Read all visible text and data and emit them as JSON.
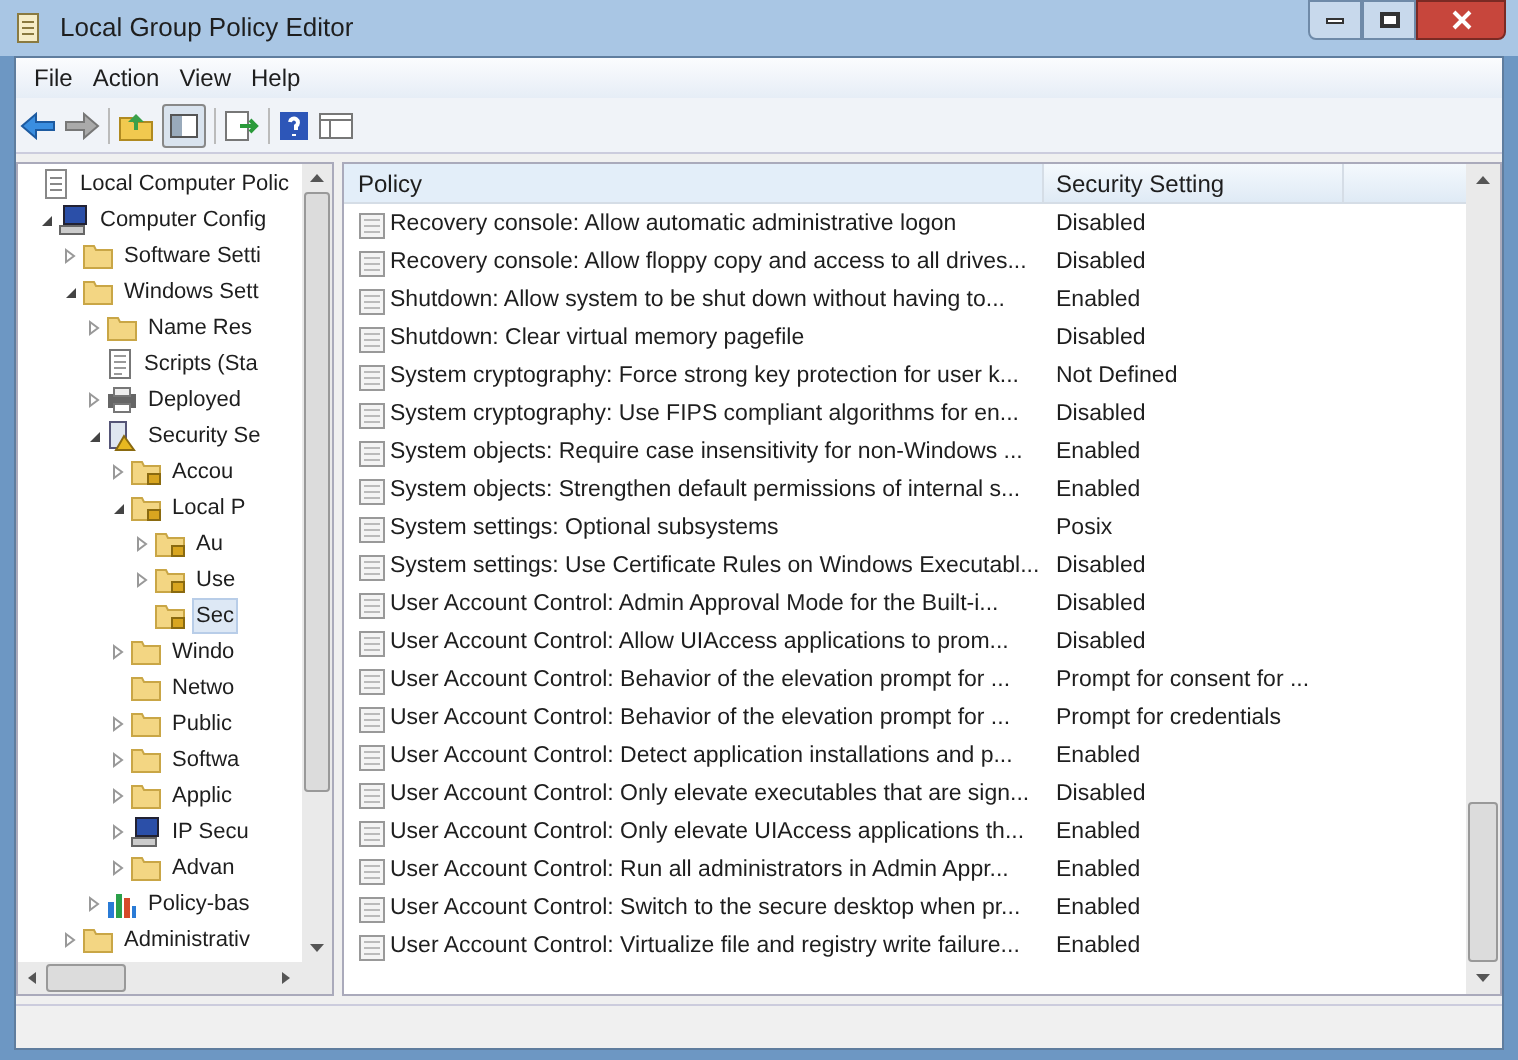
{
  "window": {
    "title": "Local Group Policy Editor"
  },
  "menu": [
    "File",
    "Action",
    "View",
    "Help"
  ],
  "tree": [
    {
      "label": "Local Computer Polic",
      "kind": "doc",
      "selected": false,
      "children": [
        {
          "label": "Computer Config",
          "kind": "computer",
          "expanded": true,
          "selected": false,
          "children": [
            {
              "label": "Software Setti",
              "kind": "folder",
              "expanded": false,
              "selected": false
            },
            {
              "label": "Windows Sett",
              "kind": "folder",
              "expanded": true,
              "selected": false,
              "children": [
                {
                  "label": "Name Res",
                  "kind": "folder",
                  "expanded": false,
                  "selected": false
                },
                {
                  "label": "Scripts (Sta",
                  "kind": "script",
                  "selected": false
                },
                {
                  "label": "Deployed",
                  "kind": "printer",
                  "expanded": false,
                  "selected": false
                },
                {
                  "label": "Security Se",
                  "kind": "security",
                  "expanded": true,
                  "selected": false,
                  "children": [
                    {
                      "label": "Accou",
                      "kind": "lock-folder",
                      "expanded": false,
                      "selected": false
                    },
                    {
                      "label": "Local P",
                      "kind": "lock-folder",
                      "expanded": true,
                      "selected": false,
                      "children": [
                        {
                          "label": "Au",
                          "kind": "lock-folder",
                          "expanded": false,
                          "selected": false
                        },
                        {
                          "label": "Use",
                          "kind": "lock-folder",
                          "expanded": false,
                          "selected": false
                        },
                        {
                          "label": "Sec",
                          "kind": "lock-folder",
                          "selected": true
                        }
                      ]
                    },
                    {
                      "label": "Windo",
                      "kind": "folder",
                      "expanded": false,
                      "selected": false
                    },
                    {
                      "label": "Netwo",
                      "kind": "folder",
                      "selected": false
                    },
                    {
                      "label": "Public",
                      "kind": "folder",
                      "expanded": false,
                      "selected": false
                    },
                    {
                      "label": "Softwa",
                      "kind": "folder",
                      "expanded": false,
                      "selected": false
                    },
                    {
                      "label": "Applic",
                      "kind": "folder",
                      "expanded": false,
                      "selected": false
                    },
                    {
                      "label": "IP Secu",
                      "kind": "computer",
                      "expanded": false,
                      "selected": false
                    },
                    {
                      "label": "Advan",
                      "kind": "folder",
                      "expanded": false,
                      "selected": false
                    }
                  ]
                },
                {
                  "label": "Policy-bas",
                  "kind": "chart",
                  "expanded": false,
                  "selected": false
                }
              ]
            },
            {
              "label": "Administrativ",
              "kind": "folder",
              "expanded": false,
              "selected": false
            }
          ]
        }
      ]
    }
  ],
  "table": {
    "columns": [
      "Policy",
      "Security Setting"
    ],
    "rows": [
      {
        "policy": "Recovery console: Allow automatic administrative logon",
        "setting": "Disabled"
      },
      {
        "policy": "Recovery console: Allow floppy copy and access to all drives...",
        "setting": "Disabled"
      },
      {
        "policy": "Shutdown: Allow system to be shut down without having to...",
        "setting": "Enabled"
      },
      {
        "policy": "Shutdown: Clear virtual memory pagefile",
        "setting": "Disabled"
      },
      {
        "policy": "System cryptography: Force strong key protection for user k...",
        "setting": "Not Defined"
      },
      {
        "policy": "System cryptography: Use FIPS compliant algorithms for en...",
        "setting": "Disabled"
      },
      {
        "policy": "System objects: Require case insensitivity for non-Windows ...",
        "setting": "Enabled"
      },
      {
        "policy": "System objects: Strengthen default permissions of internal s...",
        "setting": "Enabled"
      },
      {
        "policy": "System settings: Optional subsystems",
        "setting": "Posix"
      },
      {
        "policy": "System settings: Use Certificate Rules on Windows Executabl...",
        "setting": "Disabled"
      },
      {
        "policy": "User Account Control: Admin Approval Mode for the Built-i...",
        "setting": "Disabled"
      },
      {
        "policy": "User Account Control: Allow UIAccess applications to prom...",
        "setting": "Disabled"
      },
      {
        "policy": "User Account Control: Behavior of the elevation prompt for ...",
        "setting": "Prompt for consent for ..."
      },
      {
        "policy": "User Account Control: Behavior of the elevation prompt for ...",
        "setting": "Prompt for credentials"
      },
      {
        "policy": "User Account Control: Detect application installations and p...",
        "setting": "Enabled"
      },
      {
        "policy": "User Account Control: Only elevate executables that are sign...",
        "setting": "Disabled"
      },
      {
        "policy": "User Account Control: Only elevate UIAccess applications th...",
        "setting": "Enabled"
      },
      {
        "policy": "User Account Control: Run all administrators in Admin Appr...",
        "setting": "Enabled"
      },
      {
        "policy": "User Account Control: Switch to the secure desktop when pr...",
        "setting": "Enabled"
      },
      {
        "policy": "User Account Control: Virtualize file and registry write failure...",
        "setting": "Enabled"
      }
    ]
  }
}
